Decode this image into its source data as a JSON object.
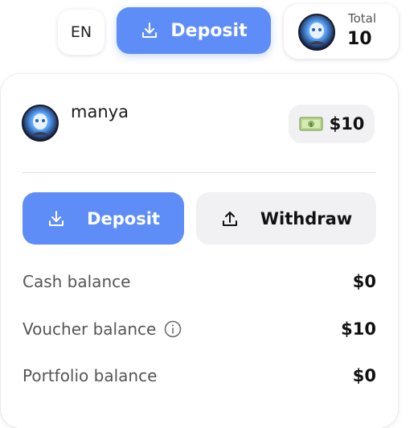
{
  "header": {
    "language": "EN",
    "deposit_label": "Deposit",
    "total_label": "Total",
    "total_value": "10"
  },
  "wallet": {
    "username": "manya",
    "balance": "$10",
    "deposit_label": "Deposit",
    "withdraw_label": "Withdraw",
    "rows": [
      {
        "label": "Cash balance",
        "value": "$0"
      },
      {
        "label": "Voucher balance",
        "value": "$10"
      },
      {
        "label": "Portfolio balance",
        "value": "$0"
      }
    ]
  },
  "colors": {
    "accent": "#5f8df8",
    "pill_bg": "#f1f1f3"
  },
  "icons": [
    "download-icon",
    "upload-icon",
    "info-icon",
    "money-icon",
    "avatar"
  ]
}
